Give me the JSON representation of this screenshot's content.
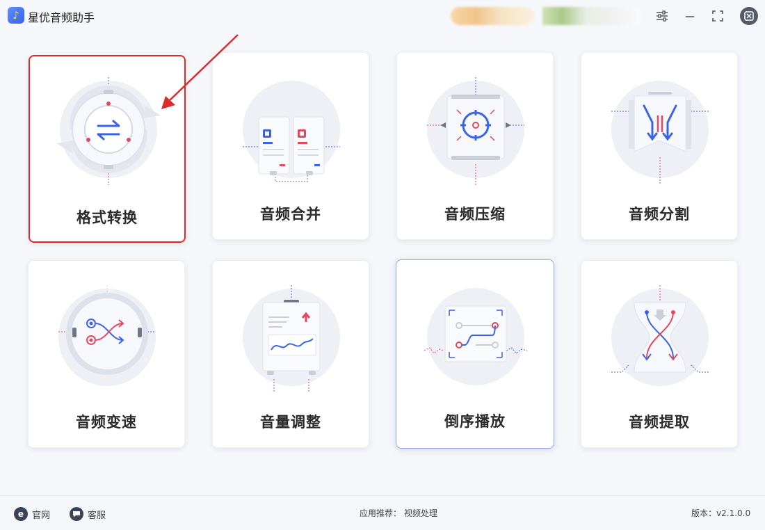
{
  "app": {
    "title": "星优音频助手",
    "logo_glyph": "♪"
  },
  "window_controls": {
    "settings_icon": "sliders-icon",
    "minimize_icon": "minimize-icon",
    "fullscreen_icon": "fullscreen-icon",
    "close_icon": "close-icon"
  },
  "cards": [
    {
      "label": "格式转换",
      "icon": "format-convert-icon"
    },
    {
      "label": "音频合并",
      "icon": "audio-merge-icon"
    },
    {
      "label": "音频压缩",
      "icon": "audio-compress-icon"
    },
    {
      "label": "音频分割",
      "icon": "audio-split-icon"
    },
    {
      "label": "音频变速",
      "icon": "audio-speed-icon"
    },
    {
      "label": "音量调整",
      "icon": "volume-adjust-icon"
    },
    {
      "label": "倒序播放",
      "icon": "reverse-play-icon"
    },
    {
      "label": "音频提取",
      "icon": "audio-extract-icon"
    }
  ],
  "footer": {
    "website_label": "官网",
    "support_label": "客服",
    "recommend_prefix": "应用推荐：",
    "recommend_link": "视频处理",
    "version_label": "版本：",
    "version_value": "v2.1.0.0"
  },
  "colors": {
    "accent_blue": "#3a63e8",
    "accent_red": "#e04a5f",
    "highlight_border": "#e02a2a"
  }
}
